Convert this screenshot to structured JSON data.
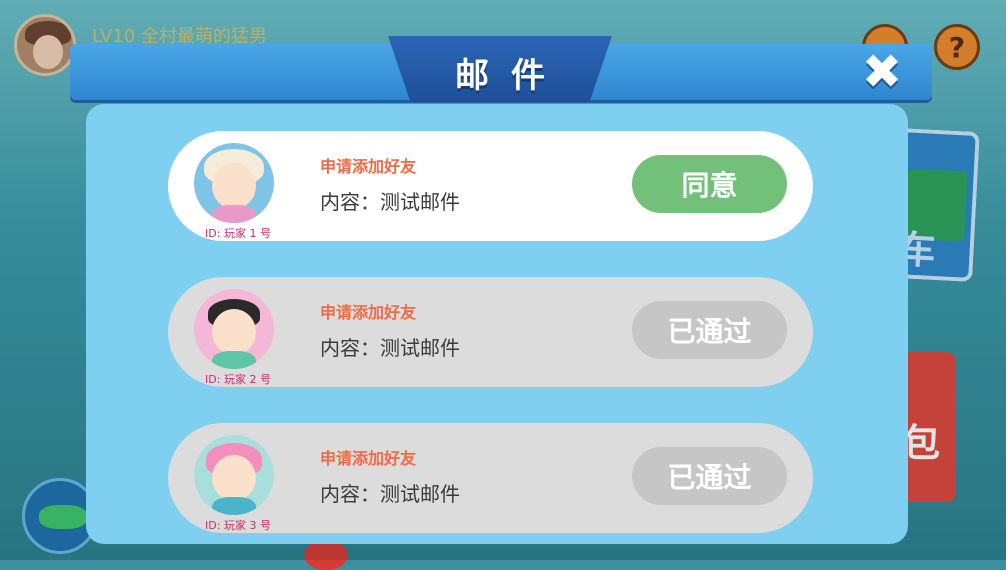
{
  "background": {
    "player_name": "LV10 全村最萌的猛男",
    "help_icon_glyph": "?",
    "side_card_1_text": "车",
    "side_card_2_text": "包"
  },
  "dialog": {
    "title": "邮件",
    "close_glyph": "✖"
  },
  "mails": [
    {
      "type": "申请添加好友",
      "content": "内容：测试邮件",
      "player_id": "ID: 玩家 1 号",
      "button_label": "同意",
      "state": "pending",
      "avatar": "white-haired-grandma-avatar"
    },
    {
      "type": "申请添加好友",
      "content": "内容：测试邮件",
      "player_id": "ID: 玩家 2 号",
      "button_label": "已通过",
      "state": "accepted",
      "avatar": "black-bun-hair-girl-avatar"
    },
    {
      "type": "申请添加好友",
      "content": "内容：测试邮件",
      "player_id": "ID: 玩家 3 号",
      "button_label": "已通过",
      "state": "accepted",
      "avatar": "pink-hair-headphones-girl-avatar"
    }
  ],
  "colors": {
    "panel": "#7ecff0",
    "header": "#2f86cf",
    "agree_button": "#73c07a",
    "done_button": "#c6c6c6",
    "mail_type": "#ef6a45",
    "player_id": "#c2306a"
  }
}
